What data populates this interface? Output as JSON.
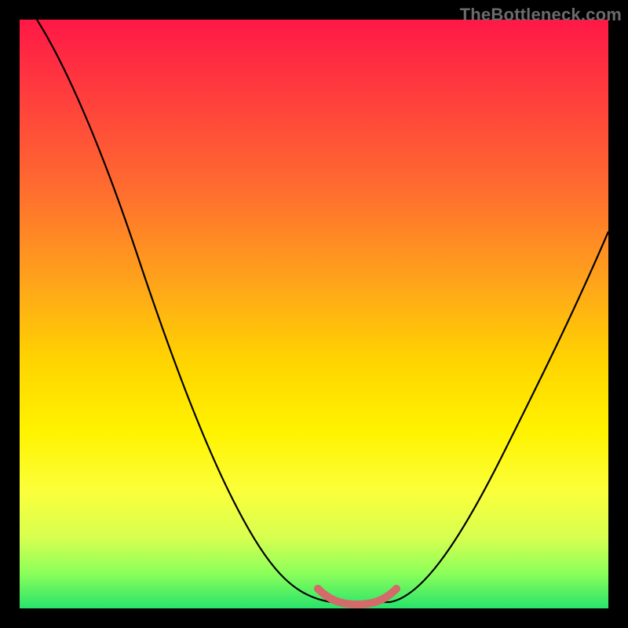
{
  "watermark": {
    "text": "TheBottleneck.com"
  },
  "chart_data": {
    "type": "line",
    "title": "",
    "xlabel": "",
    "ylabel": "",
    "xlim": [
      0,
      100
    ],
    "ylim": [
      0,
      100
    ],
    "grid": false,
    "legend": false,
    "background_gradient": {
      "direction": "vertical",
      "stops": [
        {
          "pos": 0,
          "color": "#ff1846"
        },
        {
          "pos": 12,
          "color": "#ff3b3e"
        },
        {
          "pos": 28,
          "color": "#ff6a30"
        },
        {
          "pos": 45,
          "color": "#ffa51a"
        },
        {
          "pos": 58,
          "color": "#ffd400"
        },
        {
          "pos": 70,
          "color": "#fff300"
        },
        {
          "pos": 80,
          "color": "#fbff3a"
        },
        {
          "pos": 88,
          "color": "#d7ff50"
        },
        {
          "pos": 94,
          "color": "#8cff5a"
        },
        {
          "pos": 100,
          "color": "#28e36b"
        }
      ]
    },
    "series": [
      {
        "name": "v-curve",
        "color": "#000000",
        "stroke_width": 2,
        "x": [
          3,
          10,
          20,
          30,
          38,
          45,
          50,
          55,
          60,
          63,
          68,
          75,
          82,
          90,
          100
        ],
        "y": [
          100,
          86,
          66,
          46,
          30,
          16,
          7,
          2,
          0,
          0,
          4,
          14,
          28,
          44,
          64
        ]
      },
      {
        "name": "valley-highlight",
        "color": "#d46a6a",
        "stroke_width": 7,
        "x": [
          50,
          53,
          56,
          59,
          62,
          64
        ],
        "y": [
          3,
          1,
          0,
          0,
          1,
          3
        ]
      }
    ]
  }
}
